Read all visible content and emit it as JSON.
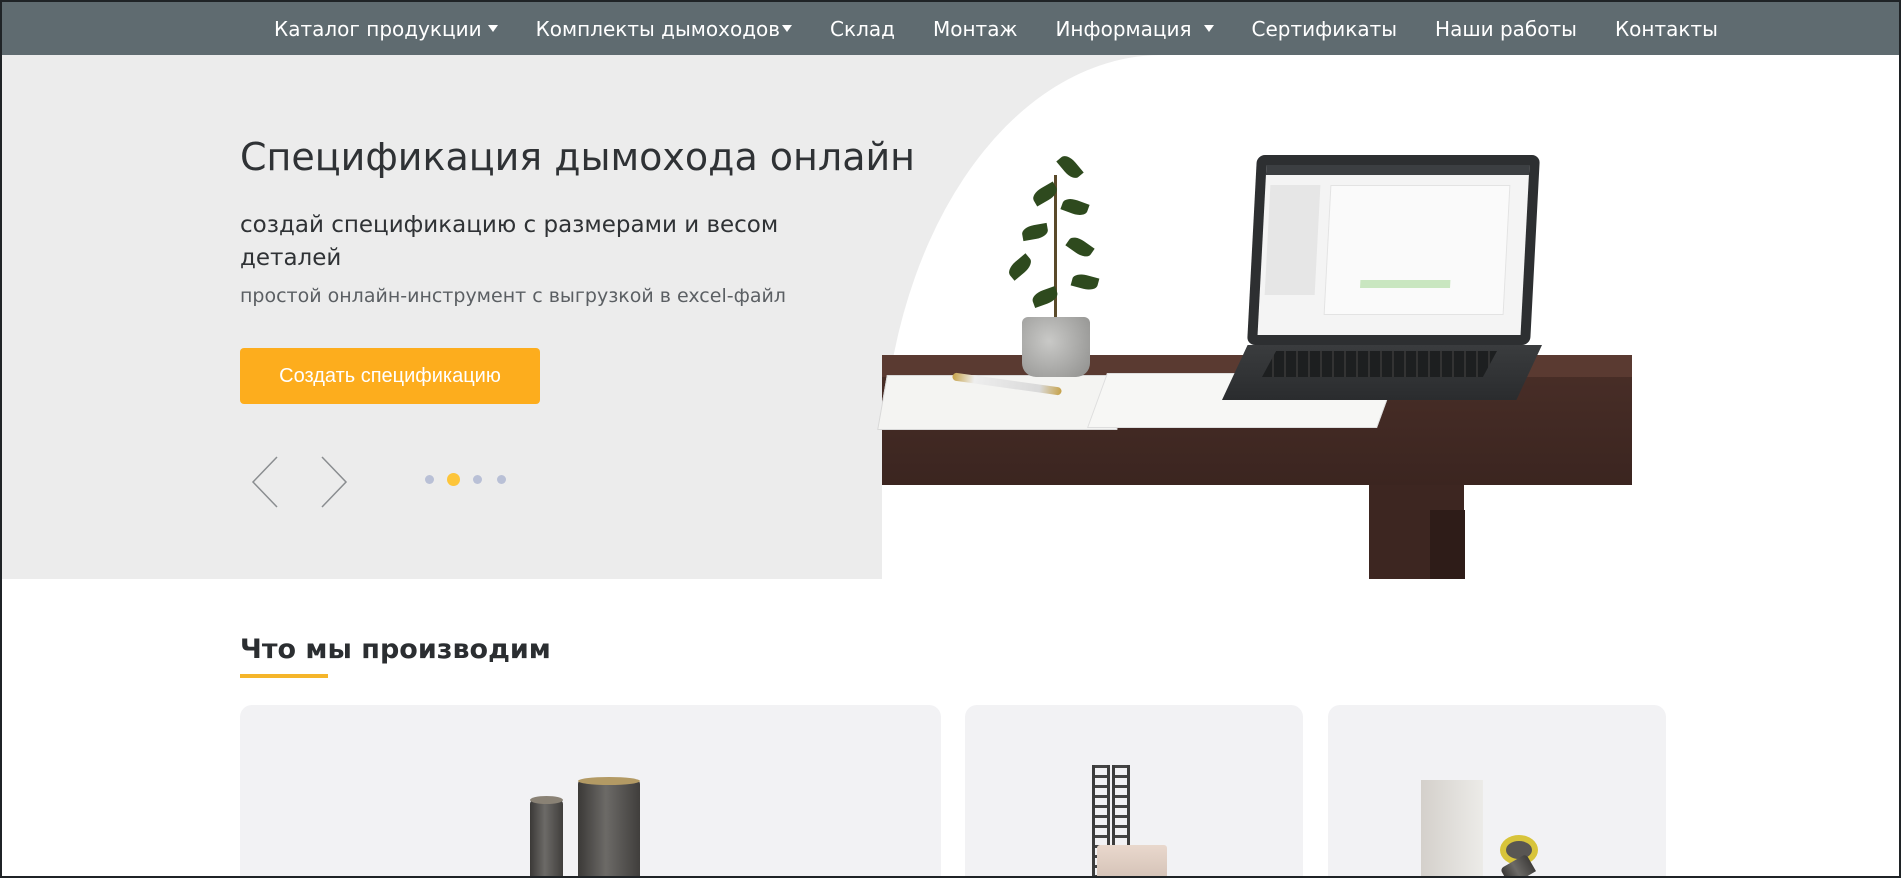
{
  "nav": {
    "items": [
      {
        "label": "Каталог продукции",
        "dropdown": true
      },
      {
        "label": "Комплекты дымоходов",
        "dropdown": true
      },
      {
        "label": "Склад",
        "dropdown": false
      },
      {
        "label": "Монтаж",
        "dropdown": false
      },
      {
        "label": "Информация",
        "dropdown": true
      },
      {
        "label": "Сертификаты",
        "dropdown": false
      },
      {
        "label": "Наши работы",
        "dropdown": false
      },
      {
        "label": "Контакты",
        "dropdown": false
      }
    ]
  },
  "hero": {
    "title": "Спецификация дымохода онлайн",
    "subtitle": "создай спецификацию с размерами и весом деталей",
    "description": "простой онлайн-инструмент с выгрузкой в excel-файл",
    "button_label": "Создать спецификацию",
    "slides_total": 4,
    "active_slide": 2
  },
  "section": {
    "title": "Что мы производим"
  },
  "colors": {
    "nav_bg": "#5f6b70",
    "accent": "#fdad1d",
    "hero_bg": "#ececec",
    "dot_active": "#fdc53a",
    "dot_inactive": "#b9c0d6"
  },
  "icons": {
    "prev": "chevron-left-icon",
    "next": "chevron-right-icon",
    "caret": "caret-down-icon"
  }
}
